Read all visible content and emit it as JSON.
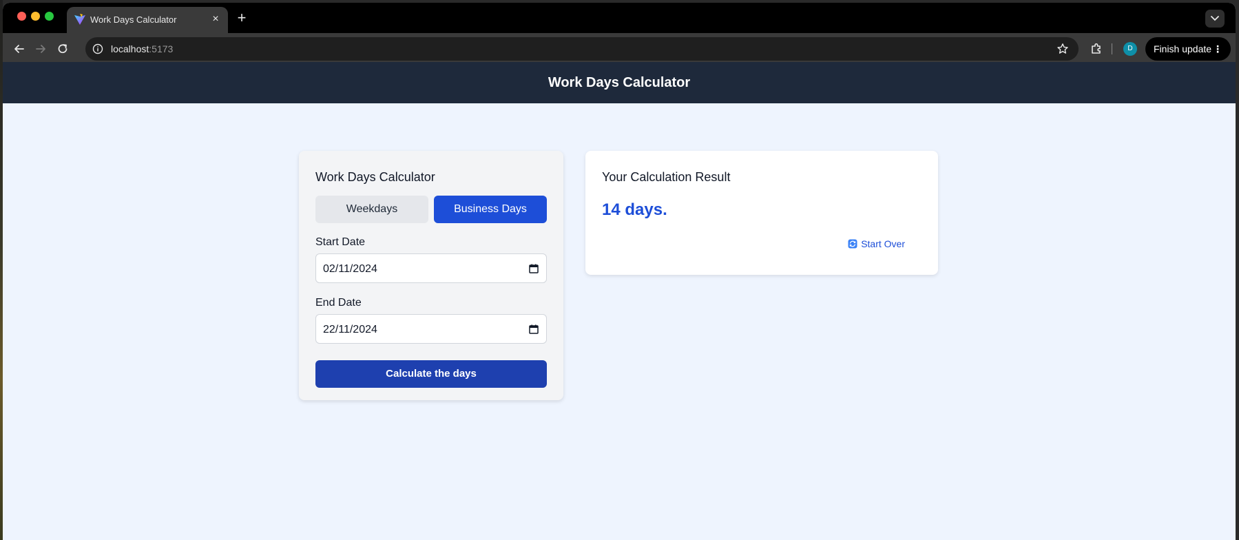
{
  "browser": {
    "tab": {
      "title": "Work Days Calculator",
      "close": "×"
    },
    "new_tab": "+",
    "url": {
      "host": "localhost",
      "port": ":5173"
    },
    "avatar_initial": "D",
    "finish_update": "Finish update"
  },
  "app": {
    "header_title": "Work Days Calculator",
    "form": {
      "title": "Work Days Calculator",
      "mode_buttons": [
        "Weekdays",
        "Business Days"
      ],
      "selected_mode": "Business Days",
      "start_date_label": "Start Date",
      "start_date_value": "02/11/2024",
      "end_date_label": "End Date",
      "end_date_value": "22/11/2024",
      "submit_label": "Calculate the days"
    },
    "result": {
      "title": "Your Calculation Result",
      "value": "14 days.",
      "start_over_label": "Start Over"
    }
  },
  "colors": {
    "header_bg": "#1e293b",
    "accent": "#1d4ed8",
    "submit_bg": "#1e40af",
    "page_bg": "#eef4fe"
  }
}
